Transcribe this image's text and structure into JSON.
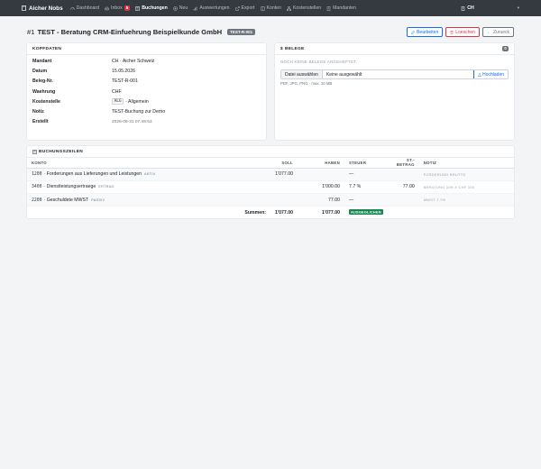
{
  "topbar": {
    "brand": "Aicher Nobs",
    "nav": [
      {
        "label": "Dashboard",
        "icon": "dashboard-icon",
        "active": false
      },
      {
        "label": "Inbox",
        "icon": "inbox-icon",
        "active": false,
        "badge": "5"
      },
      {
        "label": "Buchungen",
        "icon": "list-icon",
        "active": true
      },
      {
        "label": "Neu",
        "icon": "plus-circle-icon",
        "active": false
      },
      {
        "label": "Auswertungen",
        "icon": "bar-chart-icon",
        "active": false
      },
      {
        "label": "Export",
        "icon": "export-icon",
        "active": false
      },
      {
        "label": "Konten",
        "icon": "accounts-icon",
        "active": false
      },
      {
        "label": "Kostenstellen",
        "icon": "diagram-icon",
        "active": false
      },
      {
        "label": "Mandanten",
        "icon": "building-icon",
        "active": false
      }
    ],
    "tenant": "CH"
  },
  "page": {
    "number": "#1",
    "title": "TEST - Beratung CRM-Einfuehrung Beispielkunde GmbH",
    "ref": "TEST-R-001",
    "edit_label": "Bearbeiten",
    "delete_label": "Loeschen",
    "back_label": "Zurueck"
  },
  "kopfdaten": {
    "header": "KOPFDATEN",
    "rows": [
      {
        "key": "Mandant",
        "value": "CH · Aicher Schweiz"
      },
      {
        "key": "Datum",
        "value": "15.05.2026"
      },
      {
        "key": "Beleg-Nr.",
        "value": "TEST-R-001"
      },
      {
        "key": "Waehrung",
        "value": "CHF"
      },
      {
        "key": "Kostenstelle",
        "code": "ALG",
        "value": "· Allgemein"
      },
      {
        "key": "Notiz",
        "value": "TEST-Buchung zur Demo"
      },
      {
        "key": "Erstellt",
        "value": "2026-05-31 07:49:53",
        "muted": true
      }
    ]
  },
  "belege": {
    "header": "BELEGE",
    "count": "0",
    "empty": "NOCH KEINE BELEGE ANGEHEFTET.",
    "choose_label": "Datei auswählen",
    "file_name": "Keine ausgewählt",
    "upload_label": "Hochladen",
    "hint": "PDF, JPG, PNG · max. 10 MB"
  },
  "buchungszeilen": {
    "header": "BUCHUNGSZEILEN",
    "columns": [
      "KONTO",
      "SOLL",
      "HABEN",
      "STEUER",
      "ST.-BETRAG",
      "NOTIZ"
    ],
    "rows": [
      {
        "account": "1200",
        "name": "· Forderungen aus Lieferungen und Leistungen",
        "type": "AKTIV",
        "soll": "1'077.00",
        "haben": "",
        "steuer": "—",
        "st_betrag": "",
        "notiz": "FORDERUNG BRUTTO"
      },
      {
        "account": "3400",
        "name": "· Dienstleistungsertraege",
        "type": "ERTRAG",
        "soll": "",
        "haben": "1'000.00",
        "steuer": "7.7 %",
        "st_betrag": "77.00",
        "notiz": "BERATUNG 10H X CHF 100"
      },
      {
        "account": "2200",
        "name": "· Geschuldete MWST",
        "type": "PASSIV",
        "soll": "",
        "haben": "77.00",
        "steuer": "—",
        "st_betrag": "",
        "notiz": "MWST 7.7%"
      }
    ],
    "sum_label": "Summen:",
    "sum_soll": "1'077.00",
    "sum_haben": "1'077.00",
    "balanced_label": "AUSGEGLICHEN"
  },
  "colors": {
    "topbar": "#343a40",
    "primary": "#0d6efd",
    "danger": "#dc3545",
    "success": "#198754",
    "badge": "#6c757d"
  }
}
